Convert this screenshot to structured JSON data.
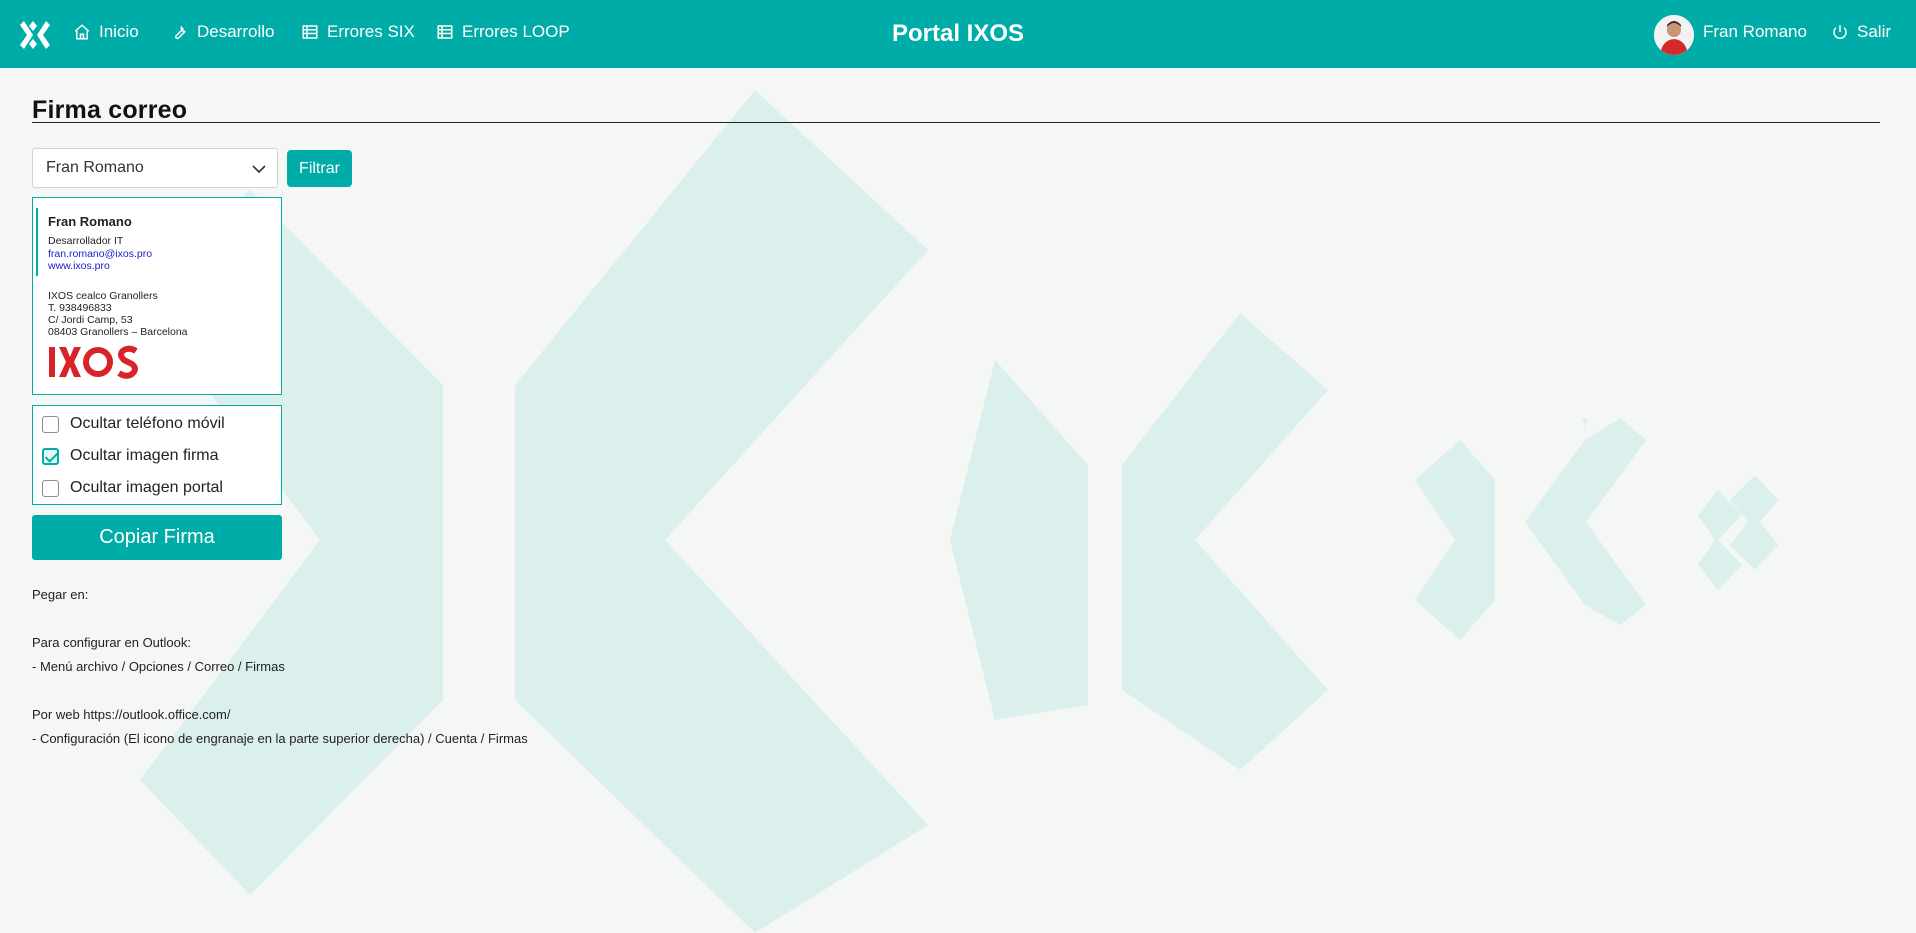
{
  "app": {
    "title": "Portal IXOS"
  },
  "nav": {
    "items": [
      {
        "label": "Inicio",
        "icon": "home-icon"
      },
      {
        "label": "Desarrollo",
        "icon": "wrench-icon"
      },
      {
        "label": "Errores SIX",
        "icon": "table-icon"
      },
      {
        "label": "Errores LOOP",
        "icon": "table-icon"
      }
    ],
    "user_name": "Fran Romano",
    "logout_label": "Salir"
  },
  "page": {
    "title": "Firma correo"
  },
  "filter": {
    "selected_user": "Fran Romano",
    "button_label": "Filtrar"
  },
  "signature": {
    "name": "Fran Romano",
    "role": "Desarrollador IT",
    "email": "fran.romano@ixos.pro",
    "website": "www.ixos.pro",
    "company": "IXOS cealco Granollers",
    "phone": "T. 938496833",
    "street": "C/ Jordi Camp, 53",
    "city": "08403 Granollers – Barcelona",
    "logo_text": "IXOS"
  },
  "options": [
    {
      "label": "Ocultar teléfono móvil",
      "checked": false
    },
    {
      "label": "Ocultar imagen firma",
      "checked": true
    },
    {
      "label": "Ocultar imagen portal",
      "checked": false
    }
  ],
  "copy_button": "Copiar Firma",
  "instructions": {
    "paste_in": "Pegar en:",
    "outlook_heading": "Para configurar en Outlook:",
    "outlook_path": "- Menú archivo / Opciones / Correo / Firmas",
    "web_heading": "Por web https://outlook.office.com/",
    "web_path": "- Configuración (El icono de engranaje en la parte superior derecha) / Cuenta / Firmas"
  },
  "colors": {
    "accent": "#00aca7",
    "background": "#f5f7f5",
    "watermark": "#dbefec",
    "logo_red": "#d8232a"
  }
}
